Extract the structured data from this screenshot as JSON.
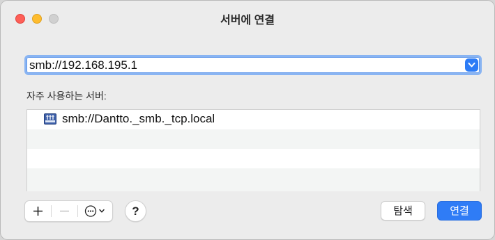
{
  "window": {
    "title": "서버에 연결"
  },
  "address": {
    "value": "smb://192.168.195.1",
    "accent_color": "#2d7cf6"
  },
  "favorites": {
    "label": "자주 사용하는 서버:",
    "items": [
      {
        "text": "smb://Dantto._smb._tcp.local",
        "icon": "network-server-icon"
      }
    ]
  },
  "toolbar": {
    "add_icon": "plus-icon",
    "remove_icon": "minus-icon",
    "more_icon": "ellipsis-circle-icon",
    "help_label": "?"
  },
  "buttons": {
    "browse_label": "탐색",
    "connect_label": "연결",
    "connect_color": "#2f7cf6"
  }
}
